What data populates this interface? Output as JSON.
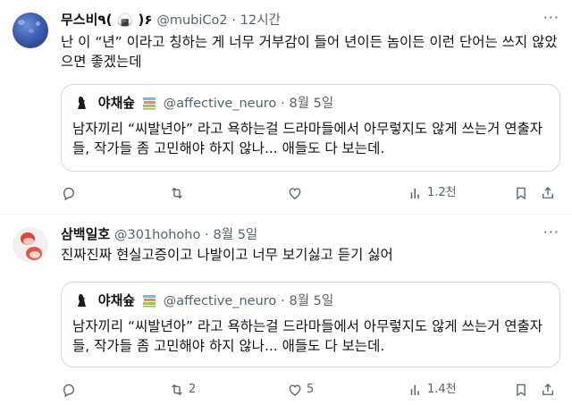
{
  "tweets": [
    {
      "name": "무스비٩( 🍙 )۶",
      "handle": "@mubiCo2",
      "dot": "·",
      "time": "12시간",
      "text": "난 이 “년” 이라고 칭하는 게 너무 거부감이 들어 년이든 놈이든 이런 단어는 쓰지 않았으면 좋겠는데",
      "quote": {
        "name": "야채슢",
        "handle": "@affective_neuro",
        "dot": "·",
        "time": "8월 5일",
        "text": "남자끼리 “씨발년아” 라고 욕하는걸 드라마들에서 아무렇지도 않게 쓰는거 연출자들, 작가들 좀 고민해야 하지 않나... 애들도 다 보는데."
      },
      "actions": {
        "reply": "",
        "retweet": "",
        "like": "",
        "views": "1.2천"
      }
    },
    {
      "name": "삼백일호",
      "handle": "@301hohoho",
      "dot": "·",
      "time": "8월 5일",
      "text": "진짜진짜 현실고증이고 나발이고 너무 보기싫고 듣기 싫어",
      "quote": {
        "name": "야채슢",
        "handle": "@affective_neuro",
        "dot": "·",
        "time": "8월 5일",
        "text": "남자끼리 “씨발년아” 라고 욕하는걸 드라마들에서 아무렇지도 않게 쓰는거 연출자들, 작가들 좀 고민해야 하지 않나... 애들도 다 보는데."
      },
      "actions": {
        "reply": "",
        "retweet": "2",
        "like": "5",
        "views": "1.4천"
      }
    }
  ],
  "more_glyph": "···",
  "colors": {
    "muted": "#536471",
    "text": "#0f1419",
    "border": "#cfd9de"
  }
}
